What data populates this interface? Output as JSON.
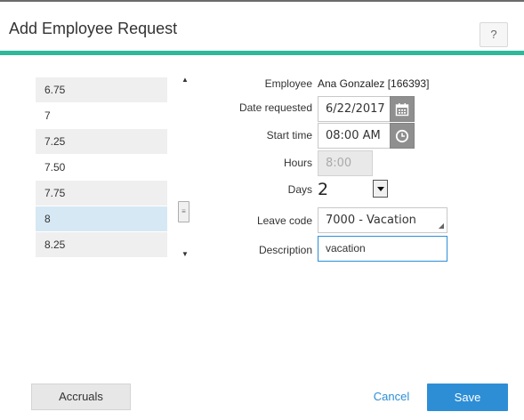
{
  "dialog": {
    "title": "Add Employee Request",
    "help_label": "?"
  },
  "hours_list": {
    "items": [
      "6.75",
      "7",
      "7.25",
      "7.50",
      "7.75",
      "8",
      "8.25"
    ],
    "selected": "8"
  },
  "form": {
    "employee_label": "Employee",
    "employee_value": "Ana Gonzalez [166393]",
    "date_label": "Date requested",
    "date_value": "6/22/2017",
    "start_label": "Start time",
    "start_value": "08:00 AM",
    "hours_label": "Hours",
    "hours_value": "8:00",
    "days_label": "Days",
    "days_value": "2",
    "leave_label": "Leave code",
    "leave_value": "7000 - Vacation",
    "desc_label": "Description",
    "desc_value": "vacation"
  },
  "footer": {
    "accruals_label": "Accruals",
    "cancel_label": "Cancel",
    "save_label": "Save"
  },
  "colors": {
    "accent": "#2fb89a",
    "primary": "#2d8ed6",
    "selected_row": "#d7e8f5"
  },
  "icons": {
    "date_picker": "calendar-icon",
    "time_picker": "clock-icon"
  }
}
